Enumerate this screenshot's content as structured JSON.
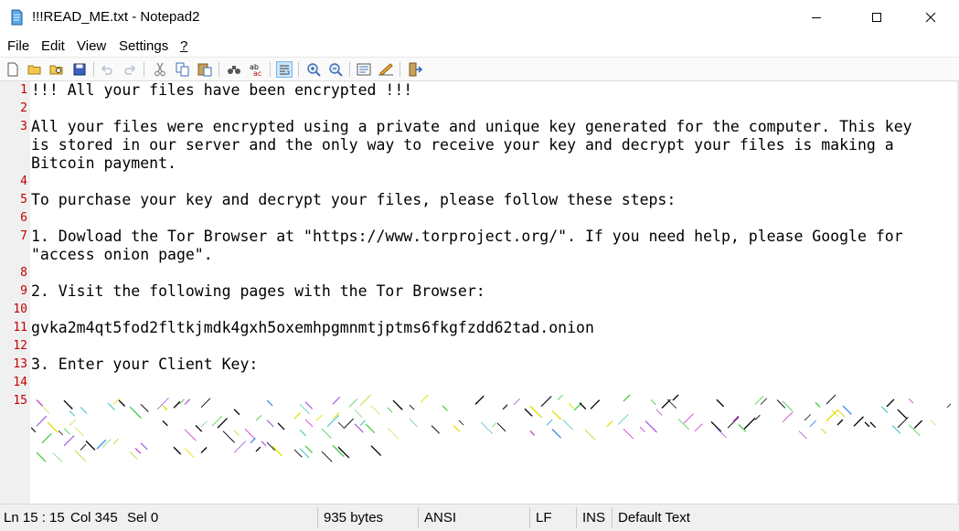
{
  "window": {
    "title": "!!!READ_ME.txt - Notepad2",
    "icons": {
      "app": "notepad2-icon",
      "minimize": "minimize-icon",
      "maximize": "maximize-icon",
      "close": "close-icon"
    }
  },
  "menu": {
    "items": [
      {
        "label": "File"
      },
      {
        "label": "Edit"
      },
      {
        "label": "View"
      },
      {
        "label": "Settings"
      },
      {
        "label": "?"
      }
    ]
  },
  "toolbar": {
    "buttons": [
      {
        "icon": "new-file-icon"
      },
      {
        "icon": "open-folder-icon"
      },
      {
        "icon": "browse-icon"
      },
      {
        "icon": "save-icon"
      },
      {
        "icon": "undo-icon"
      },
      {
        "icon": "redo-icon"
      },
      {
        "icon": "cut-icon"
      },
      {
        "icon": "copy-icon"
      },
      {
        "icon": "paste-icon"
      },
      {
        "icon": "find-icon"
      },
      {
        "icon": "replace-icon"
      },
      {
        "icon": "word-wrap-icon",
        "pressed": true
      },
      {
        "icon": "zoom-in-icon"
      },
      {
        "icon": "zoom-out-icon"
      },
      {
        "icon": "scheme-icon"
      },
      {
        "icon": "customize-icon"
      },
      {
        "icon": "exit-icon"
      }
    ]
  },
  "editor": {
    "line_numbers": [
      "1",
      "2",
      "3",
      "4",
      "5",
      "6",
      "7",
      "8",
      "9",
      "10",
      "11",
      "12",
      "13",
      "14",
      "15"
    ],
    "lines": [
      "!!! All your files have been encrypted !!!",
      "",
      "All your files were encrypted using a private and unique key generated for the computer. This key",
      "is stored in our server and the only way to receive your key and decrypt your files is making a",
      "Bitcoin payment.",
      "",
      "To purchase your key and decrypt your files, please follow these steps:",
      "",
      "1. Dowload the Tor Browser at \"https://www.torproject.org/\". If you need help, please Google for",
      "\"access onion page\".",
      "",
      "2. Visit the following pages with the Tor Browser:",
      "",
      "gvka2m4qt5fod2fltkjmdk4gxh5oxemhpgmnmtjptms6fkgfzdd62tad.onion",
      "",
      "3. Enter your Client Key:"
    ]
  },
  "status": {
    "position": "Ln 15 : 15",
    "column": "Col 345",
    "selection": "Sel 0",
    "size": "935 bytes",
    "encoding": "ANSI",
    "line_ending": "LF",
    "mode": "INS",
    "scheme": "Default Text"
  },
  "colors": {
    "line_number": "#c00000",
    "gutter": "#f0f0f0",
    "statusbar": "#f0f0f0"
  }
}
